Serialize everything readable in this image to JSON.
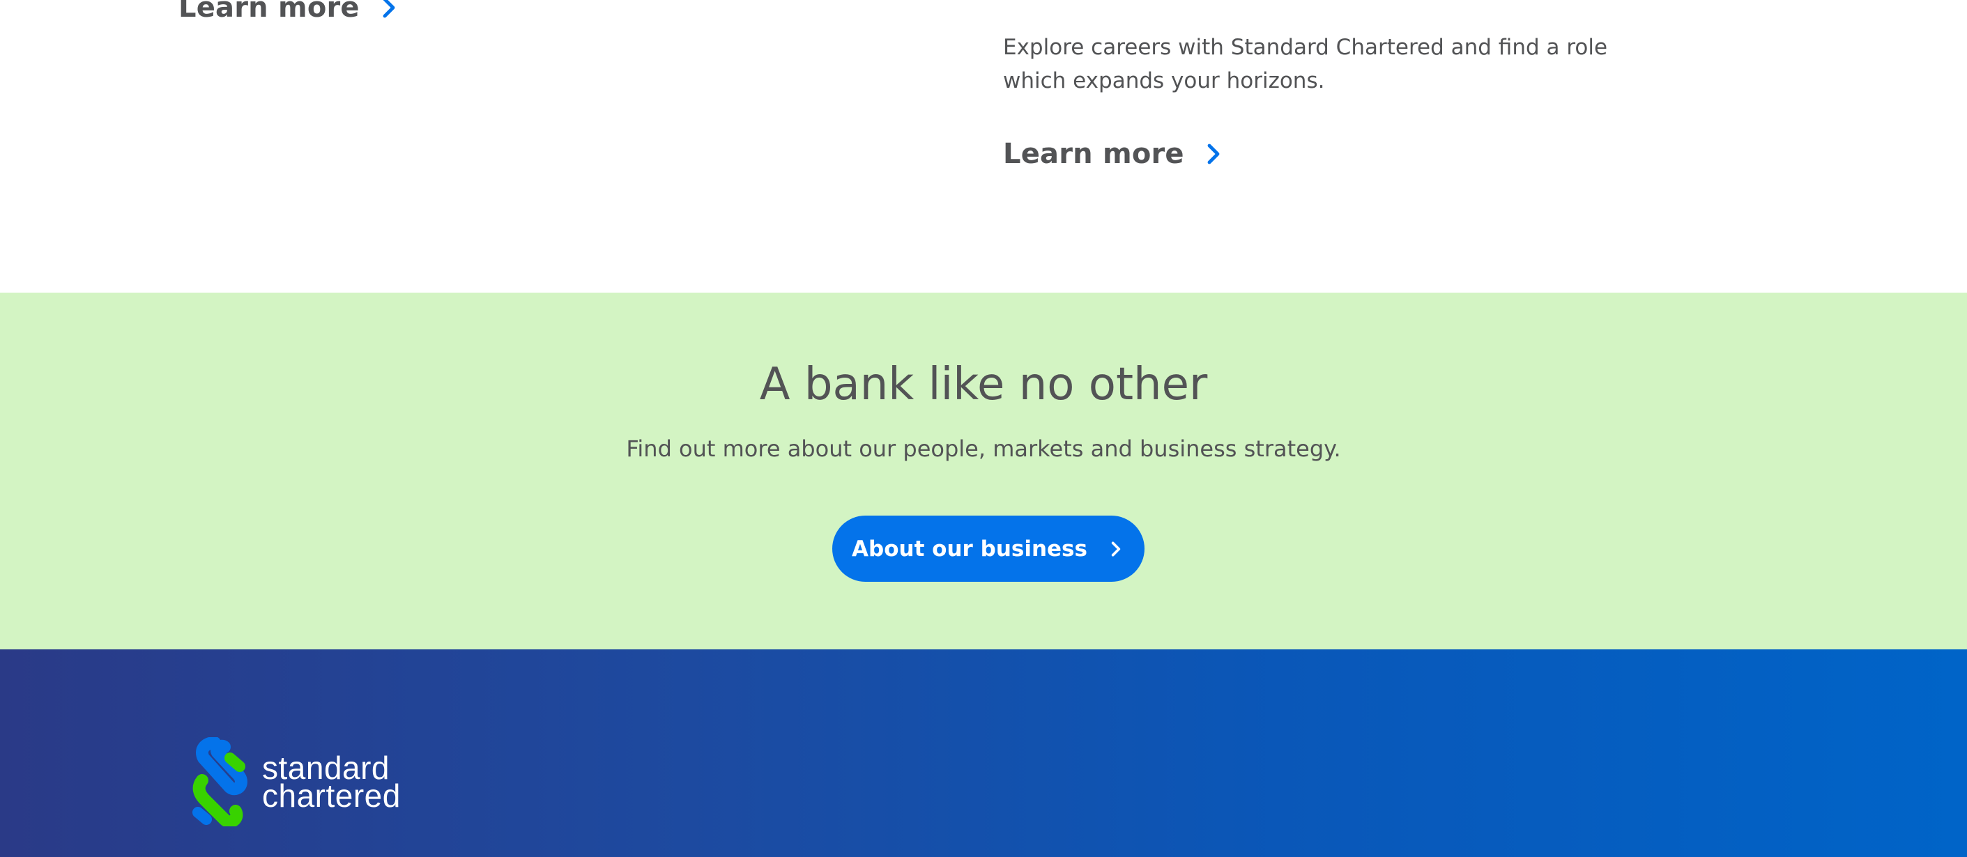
{
  "top": {
    "left_link_label": "Learn more",
    "careers_text": "Explore careers with Standard Chartered and find a role which expands your horizons.",
    "right_link_label": "Learn more"
  },
  "promo": {
    "title": "A bank like no other",
    "subtitle": "Find out more about our people, markets and business strategy.",
    "button_label": "About our business"
  },
  "footer": {
    "logo_line1": "standard",
    "logo_line2": "chartered"
  },
  "icons": {
    "link_chevron": "chevron-right-icon",
    "button_chevron": "chevron-right-icon",
    "logo": "standard-chartered-logo"
  },
  "colors": {
    "accent_blue": "#0473ea",
    "promo_bg": "#d3f4c3",
    "text": "#525355",
    "footer_start": "#2a3a87",
    "footer_end": "#0064c8",
    "logo_green": "#38d200"
  }
}
